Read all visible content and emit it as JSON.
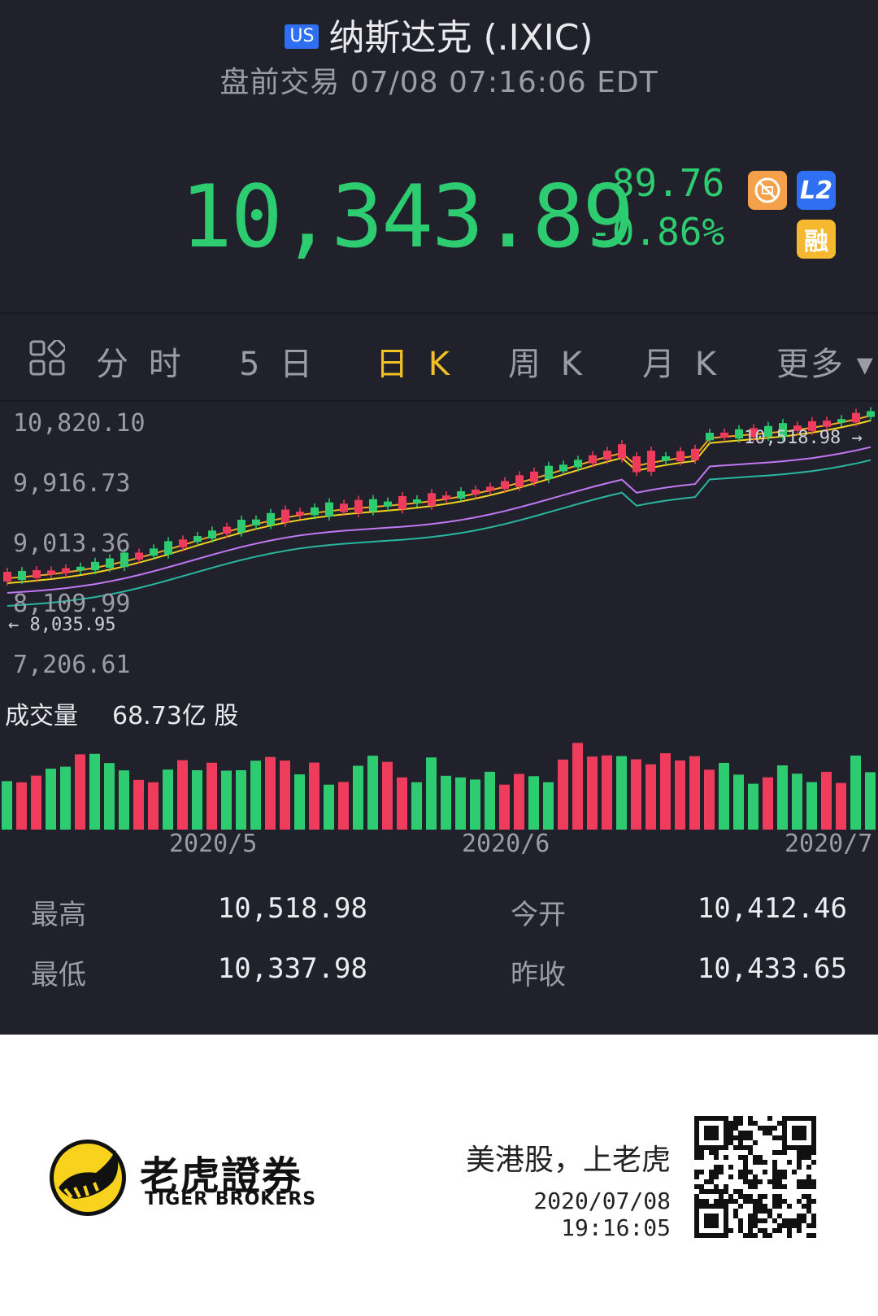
{
  "header": {
    "market_badge": "US",
    "title": "纳斯达克 (.IXIC)",
    "subtitle": "盘前交易 07/08 07:16:06 EDT"
  },
  "quote": {
    "price": "10,343.89",
    "change": "-89.76",
    "change_pct": "-0.86%",
    "color": "#2ecc71",
    "badges": [
      "L2",
      "融"
    ]
  },
  "tabs": [
    {
      "label": "分 时",
      "active": false
    },
    {
      "label": "5 日",
      "active": false
    },
    {
      "label": "日 K",
      "active": true
    },
    {
      "label": "周 K",
      "active": false
    },
    {
      "label": "月 K",
      "active": false
    },
    {
      "label": "更多 ▾",
      "active": false
    }
  ],
  "chart_data": {
    "type": "candlestick",
    "y_labels": [
      "10,820.10",
      "9,916.73",
      "9,013.36",
      "8,109.99",
      "7,206.61"
    ],
    "ylim": [
      7206.61,
      10820.1
    ],
    "max_marker": "10,518.98",
    "min_marker": "8,035.95",
    "volume_label": "成交量",
    "volume_value": "68.73亿 股",
    "x_labels": [
      "2020/5",
      "2020/6",
      "2020/7"
    ],
    "colors": {
      "up": "#f03c5c",
      "down": "#2ecc71",
      "ma1": "#f5a623",
      "ma2": "#f2d21f",
      "ma3": "#c277f5",
      "ma4": "#29b7a0"
    }
  },
  "stats": [
    {
      "label": "最高",
      "value": "10,518.98"
    },
    {
      "label": "今开",
      "value": "10,412.46"
    },
    {
      "label": "最低",
      "value": "10,337.98"
    },
    {
      "label": "昨收",
      "value": "10,433.65"
    }
  ],
  "footer": {
    "brand_cn": "老虎證券",
    "brand_en": "TIGER BROKERS",
    "slogan": "美港股，上老虎",
    "timestamp": "2020/07/08 19:16:05"
  }
}
